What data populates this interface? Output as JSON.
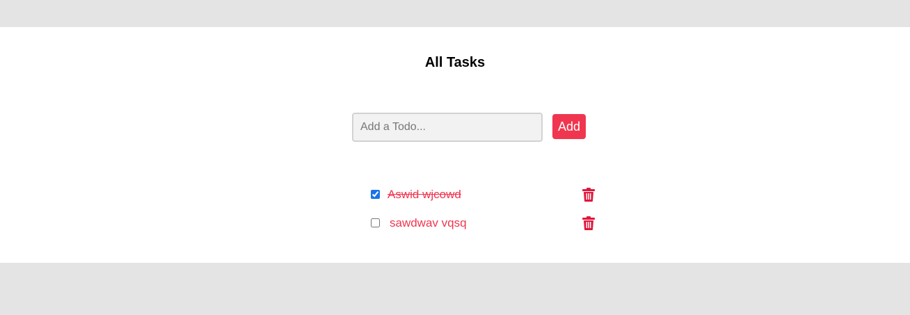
{
  "header": {
    "title": "All Tasks"
  },
  "form": {
    "input_value": "",
    "input_placeholder": "Add a Todo...",
    "add_label": "Add"
  },
  "todos": [
    {
      "text": "Aswid wjcowd",
      "completed": true
    },
    {
      "text": "sawdwav vqsq",
      "completed": false
    }
  ],
  "icons": {
    "delete": "trash-icon"
  },
  "colors": {
    "accent": "#f0364f",
    "trash": "#e0173c",
    "page_background": "#e4e4e4",
    "card_background": "#ffffff"
  }
}
